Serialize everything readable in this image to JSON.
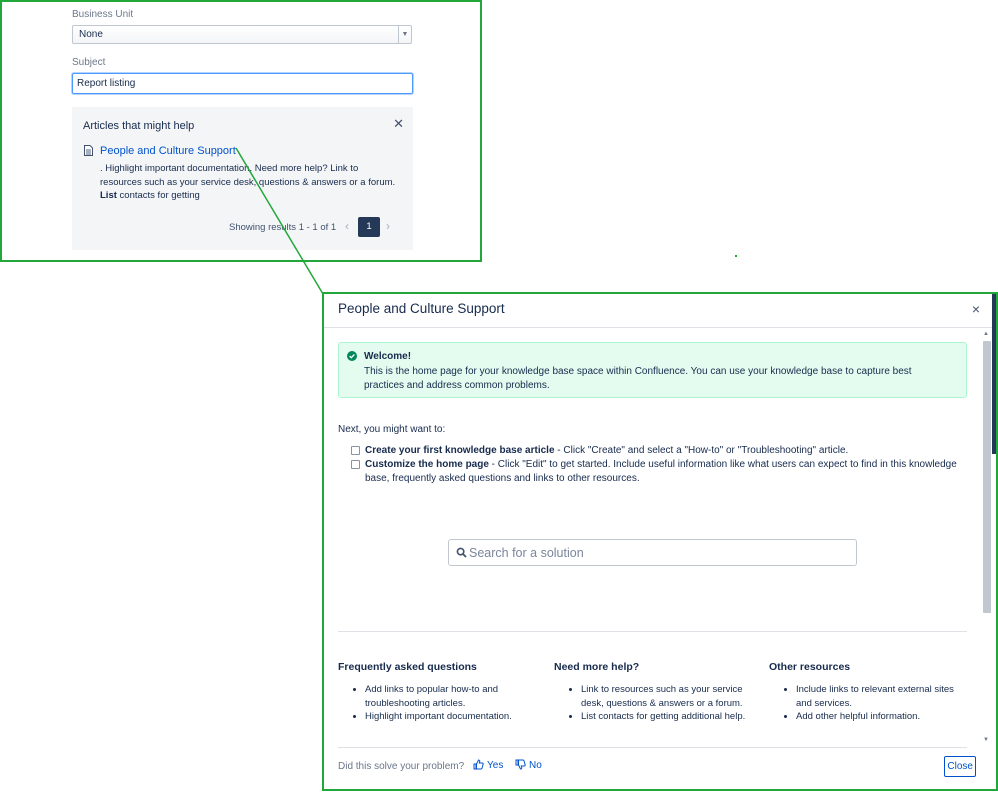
{
  "form": {
    "business_unit_label": "Business Unit",
    "business_unit_value": "None",
    "subject_label": "Subject",
    "subject_value": "Report listing"
  },
  "help_panel": {
    "title": "Articles that might help",
    "article_title": "People and Culture Support",
    "article_desc_1": ". Highlight important documentation. Need more help? Link to resources such as your service desk, questions & answers or a forum.",
    "article_desc_bold": "List",
    "article_desc_2": " contacts for getting",
    "results_text": "Showing results 1 - 1 of 1",
    "current_page": "1",
    "prev_glyph": "‹",
    "next_glyph": "›"
  },
  "dialog": {
    "title": "People and Culture Support",
    "close_glyph": "×",
    "welcome_title": "Welcome!",
    "welcome_text": "This is the home page for your knowledge base space within Confluence. You can use your knowledge base to capture best practices and address common problems.",
    "next_text": "Next, you might want to:",
    "tasks": [
      {
        "bold": "Create your first knowledge base article",
        "text": " - Click \"Create\" and select a \"How-to\" or \"Troubleshooting\" article."
      },
      {
        "bold": "Customize the home page",
        "text": " - Click \"Edit\" to get started. Include useful information like what users can expect to find in this knowledge base, frequently asked questions and links to other resources."
      }
    ],
    "search_placeholder": "Search for a solution",
    "columns": [
      {
        "title": "Frequently asked questions",
        "items": [
          "Add links to popular how-to and troubleshooting articles.",
          "Highlight important documentation."
        ]
      },
      {
        "title": "Need more help?",
        "items": [
          "Link to resources such as your service desk, questions & answers or a forum.",
          "List contacts for getting additional help."
        ]
      },
      {
        "title": "Other resources",
        "items": [
          "Include links to relevant external sites and services.",
          "Add other helpful information."
        ]
      }
    ],
    "solve_question": "Did this solve your problem?",
    "yes_label": "Yes",
    "no_label": "No",
    "close_label": "Close"
  },
  "colors": {
    "highlight_border": "#22a83a",
    "link": "#0052cc",
    "success_bg": "#e3fcef",
    "success_icon": "#00875a",
    "page_active_bg": "#253858"
  }
}
